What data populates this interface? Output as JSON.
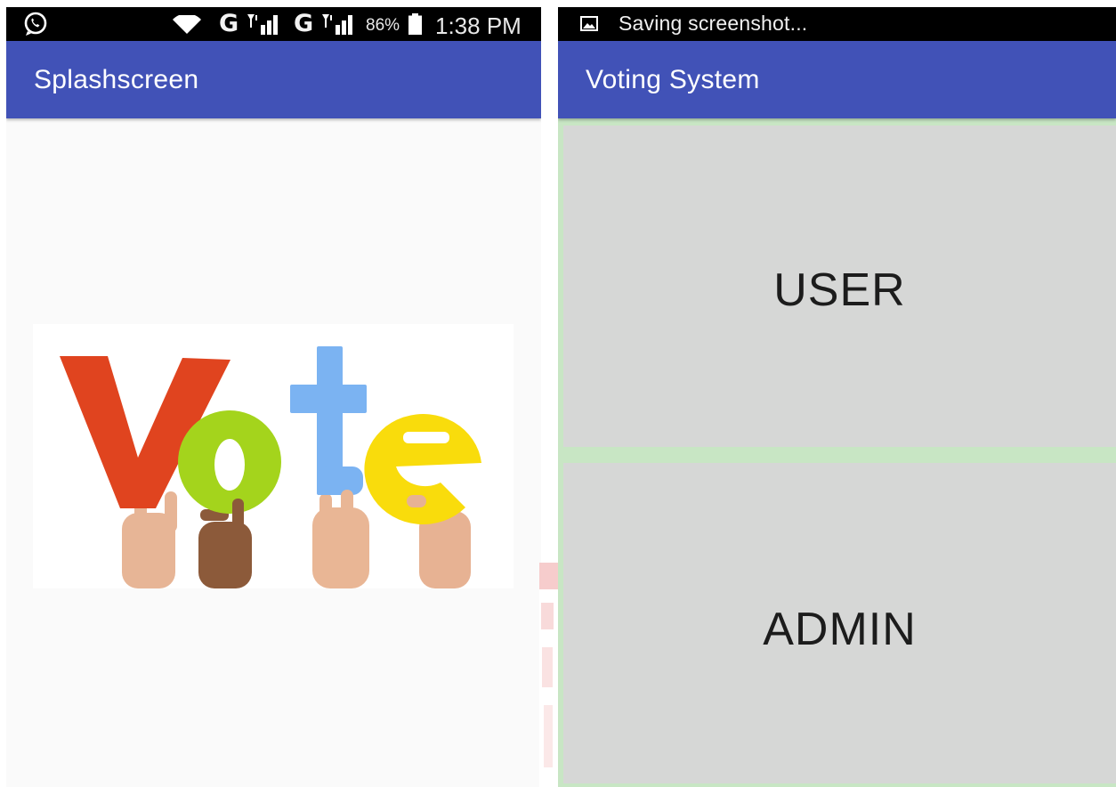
{
  "left_screen": {
    "status_bar": {
      "left_icon": "whatsapp-icon",
      "icons": [
        "wifi-icon",
        "signal-icon",
        "signal-icon"
      ],
      "network_1": "G",
      "network_2": "G",
      "battery": "86%",
      "time": "1:38 PM"
    },
    "app_bar": {
      "title": "Splashscreen"
    },
    "image": {
      "name": "vote-image",
      "letters": [
        "V",
        "o",
        "t",
        "e"
      ]
    }
  },
  "right_screen": {
    "status_bar": {
      "icon": "gallery-icon",
      "notification": "Saving screenshot..."
    },
    "app_bar": {
      "title": "Voting System"
    },
    "buttons": {
      "user": "USER",
      "admin": "ADMIN"
    }
  },
  "colors": {
    "app_bar": "#4152b7",
    "status_bar": "#000000",
    "splash_background": "#fafafa",
    "button_background": "#d6d7d6",
    "button_border": "#c8e6c4",
    "vote_v": "#e0441f",
    "vote_o": "#a4d41c",
    "vote_t": "#7bb3f2",
    "vote_e": "#f9dc0c"
  }
}
